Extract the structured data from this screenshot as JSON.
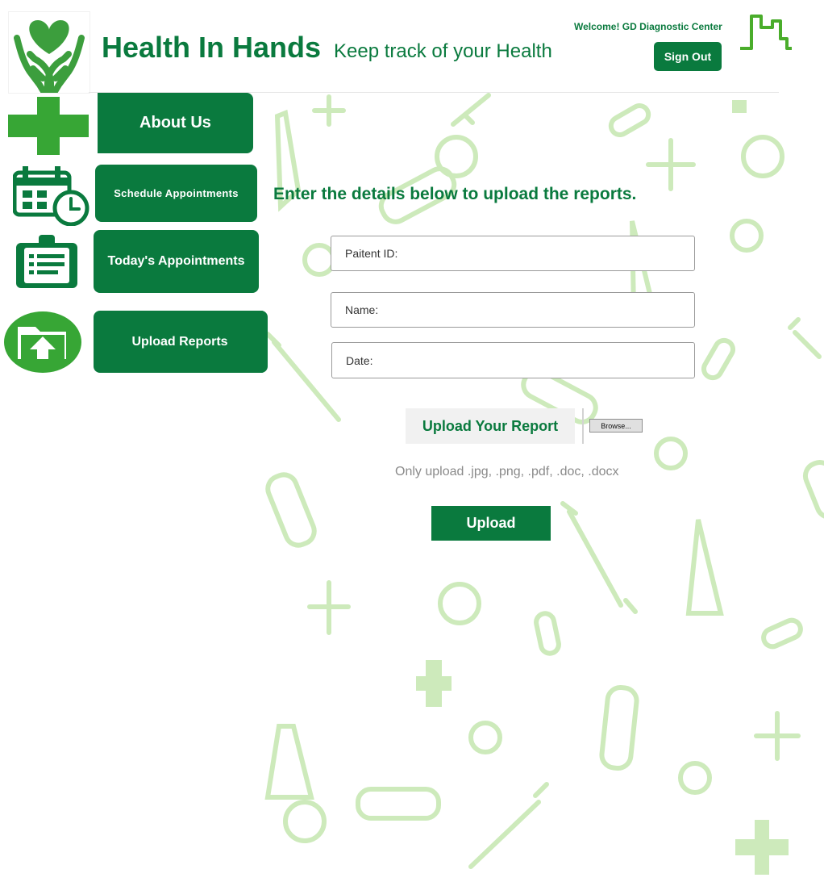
{
  "header": {
    "brand": "Health In Hands",
    "tagline": "Keep track of your Health",
    "welcome": "Welcome! GD Diagnostic Center",
    "signout_label": "Sign Out"
  },
  "nav": {
    "about": "About Us",
    "schedule": "Schedule  Appointments",
    "today": "Today's Appointments",
    "upload_reports": "Upload Reports"
  },
  "form": {
    "title": "Enter the details below to upload the reports.",
    "patient_id_placeholder": "Paitent ID:",
    "name_placeholder": "Name:",
    "date_placeholder": "Date:",
    "upload_label": "Upload Your Report",
    "browse_label": "Browse...",
    "hint": "Only upload .jpg, .png, .pdf, .doc, .docx",
    "submit_label": "Upload"
  },
  "icons": {
    "logo": "heart-hands-icon",
    "header": "city-skyline-icon",
    "about": "medical-cross-icon",
    "schedule": "calendar-clock-icon",
    "today": "clipboard-icon",
    "upload": "upload-folder-icon"
  },
  "colors": {
    "primary": "#0a7a3e",
    "pattern": "#cdeabb"
  }
}
